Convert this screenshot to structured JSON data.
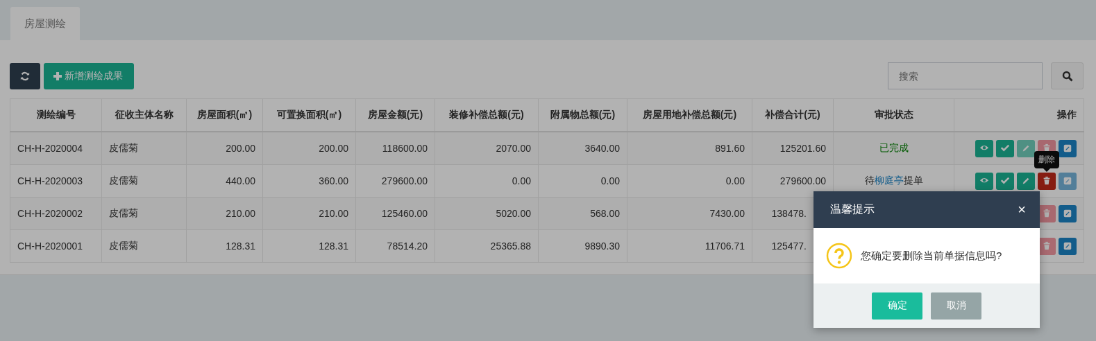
{
  "tabs": [
    {
      "label": "房屋测绘",
      "selected": true
    }
  ],
  "toolbar": {
    "add_button": "新增测绘成果",
    "search": {
      "placeholder": "搜索"
    }
  },
  "table": {
    "columns": [
      "测绘编号",
      "征收主体名称",
      "房屋面积(㎡)",
      "可置换面积(㎡)",
      "房屋金额(元)",
      "装修补偿总额(元)",
      "附属物总额(元)",
      "房屋用地补偿总额(元)",
      "补偿合计(元)",
      "审批状态",
      "操作"
    ],
    "rows": [
      {
        "cells": [
          "CH-H-2020004",
          "皮儒菊",
          "200.00",
          "200.00",
          "118600.00",
          "2070.00",
          "3640.00",
          "891.60",
          "125201.60"
        ],
        "status": {
          "kind": "done",
          "parts": [
            "已完成"
          ]
        },
        "actions": [
          {
            "kind": "view",
            "disabled": false
          },
          {
            "kind": "approve",
            "disabled": false
          },
          {
            "kind": "edit",
            "disabled": true
          },
          {
            "kind": "delete",
            "disabled": true
          },
          {
            "kind": "modify",
            "disabled": false
          }
        ]
      },
      {
        "cells": [
          "CH-H-2020003",
          "皮儒菊",
          "440.00",
          "360.00",
          "279600.00",
          "0.00",
          "0.00",
          "0.00",
          "279600.00"
        ],
        "status": {
          "kind": "pending",
          "parts": [
            "待",
            "柳庭亭",
            "提单"
          ]
        },
        "actions": [
          {
            "kind": "view",
            "disabled": false
          },
          {
            "kind": "approve",
            "disabled": false
          },
          {
            "kind": "edit",
            "disabled": false
          },
          {
            "kind": "delete",
            "disabled": false,
            "tooltip": "删除"
          },
          {
            "kind": "modify",
            "disabled": true
          }
        ]
      },
      {
        "cells": [
          "CH-H-2020002",
          "皮儒菊",
          "210.00",
          "210.00",
          "125460.00",
          "5020.00",
          "568.00",
          "7430.00",
          "138478."
        ],
        "actions": [
          {
            "kind": "delete",
            "disabled": true
          },
          {
            "kind": "modify",
            "disabled": false
          }
        ]
      },
      {
        "cells": [
          "CH-H-2020001",
          "皮儒菊",
          "128.31",
          "128.31",
          "78514.20",
          "25365.88",
          "9890.30",
          "11706.71",
          "125477."
        ],
        "actions": [
          {
            "kind": "delete",
            "disabled": true
          },
          {
            "kind": "modify",
            "disabled": false
          }
        ]
      }
    ]
  },
  "dialog": {
    "title": "温馨提示",
    "close": "×",
    "message": "您确定要删除当前单据信息吗?",
    "buttons": [
      {
        "kind": "primary",
        "label": "确定"
      },
      {
        "kind": "secondary",
        "label": "取消"
      }
    ]
  }
}
